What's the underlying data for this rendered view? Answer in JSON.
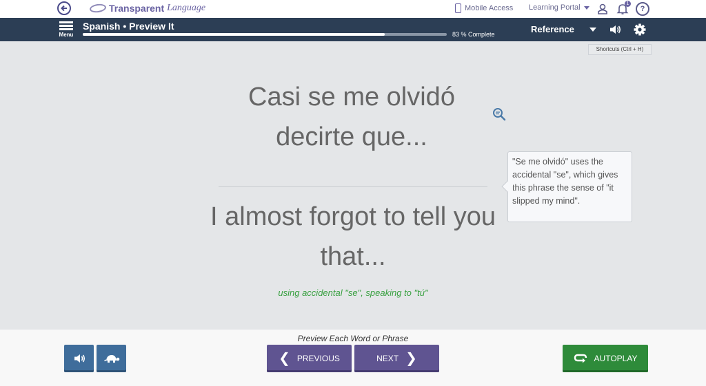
{
  "topbar": {
    "logo_brand": "Transparent",
    "logo_brand_b": "Language",
    "mobile_access": "Mobile Access",
    "learning_portal": "Learning Portal",
    "notification_count": "1",
    "help_glyph": "?"
  },
  "header": {
    "menu_label": "Menu",
    "course_title": "Spanish • Preview It",
    "progress_percent": 83,
    "progress_text": "83 % Complete",
    "reference_label": "Reference"
  },
  "shortcuts_hint": "Shortcuts  (Ctrl + H)",
  "content": {
    "target_phrase": "Casi se me olvidó decirte que...",
    "translation": "I almost forgot to tell you that...",
    "note": "using accidental \"se\", speaking to \"tú\""
  },
  "tooltip": {
    "text": "\"Se me olvidó\" uses the accidental \"se\", which gives this phrase the sense of \"it slipped my mind\"."
  },
  "footer": {
    "instruction": "Preview Each Word or Phrase",
    "previous_label": "PREVIOUS",
    "next_label": "NEXT",
    "autoplay_label": "AUTOPLAY"
  },
  "colors": {
    "header_bg": "#2c3e55",
    "accent_purple": "#5f5491",
    "accent_green": "#2e8b3a",
    "accent_blue": "#3f6d9b",
    "note_green": "#3aa142"
  },
  "icons": [
    "back-arrow-icon",
    "phone-icon",
    "user-icon",
    "bell-icon",
    "help-icon",
    "hamburger-icon",
    "speaker-icon",
    "gear-icon",
    "zoom-icon",
    "turtle-icon",
    "chevron-left-icon",
    "chevron-right-icon",
    "autoplay-icon"
  ]
}
